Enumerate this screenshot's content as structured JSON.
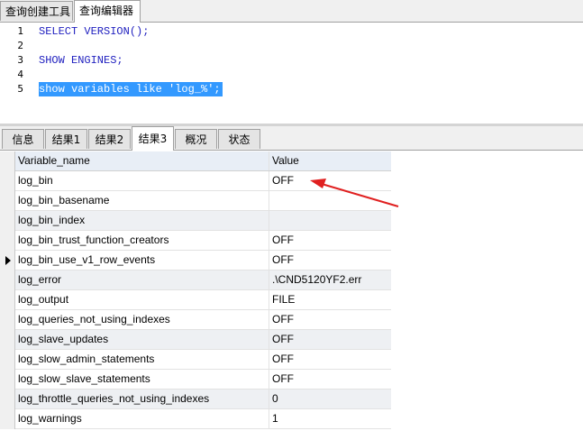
{
  "top_tabs": [
    {
      "label": "查询创建工具"
    },
    {
      "label": "查询编辑器"
    }
  ],
  "editor": {
    "lines": [
      {
        "no": "1",
        "text": "SELECT VERSION();"
      },
      {
        "no": "2",
        "text": ""
      },
      {
        "no": "3",
        "text": "SHOW ENGINES;"
      },
      {
        "no": "4",
        "text": ""
      },
      {
        "no": "5",
        "text": "show variables like 'log_%';"
      }
    ]
  },
  "result_tabs": [
    {
      "label": "信息"
    },
    {
      "label": "结果1"
    },
    {
      "label": "结果2"
    },
    {
      "label": "结果3"
    },
    {
      "label": "概况"
    },
    {
      "label": "状态"
    }
  ],
  "grid": {
    "columns": [
      "Variable_name",
      "Value"
    ],
    "rows": [
      [
        "log_bin",
        "OFF"
      ],
      [
        "log_bin_basename",
        ""
      ],
      [
        "log_bin_index",
        ""
      ],
      [
        "log_bin_trust_function_creators",
        "OFF"
      ],
      [
        "log_bin_use_v1_row_events",
        "OFF"
      ],
      [
        "log_error",
        ".\\CND5120YF2.err"
      ],
      [
        "log_output",
        "FILE"
      ],
      [
        "log_queries_not_using_indexes",
        "OFF"
      ],
      [
        "log_slave_updates",
        "OFF"
      ],
      [
        "log_slow_admin_statements",
        "OFF"
      ],
      [
        "log_slow_slave_statements",
        "OFF"
      ],
      [
        "log_throttle_queries_not_using_indexes",
        "0"
      ],
      [
        "log_warnings",
        "1"
      ]
    ]
  },
  "colors": {
    "keyword": "#1f1fbf",
    "selection": "#3399ff",
    "annotation_arrow": "#e02020"
  }
}
